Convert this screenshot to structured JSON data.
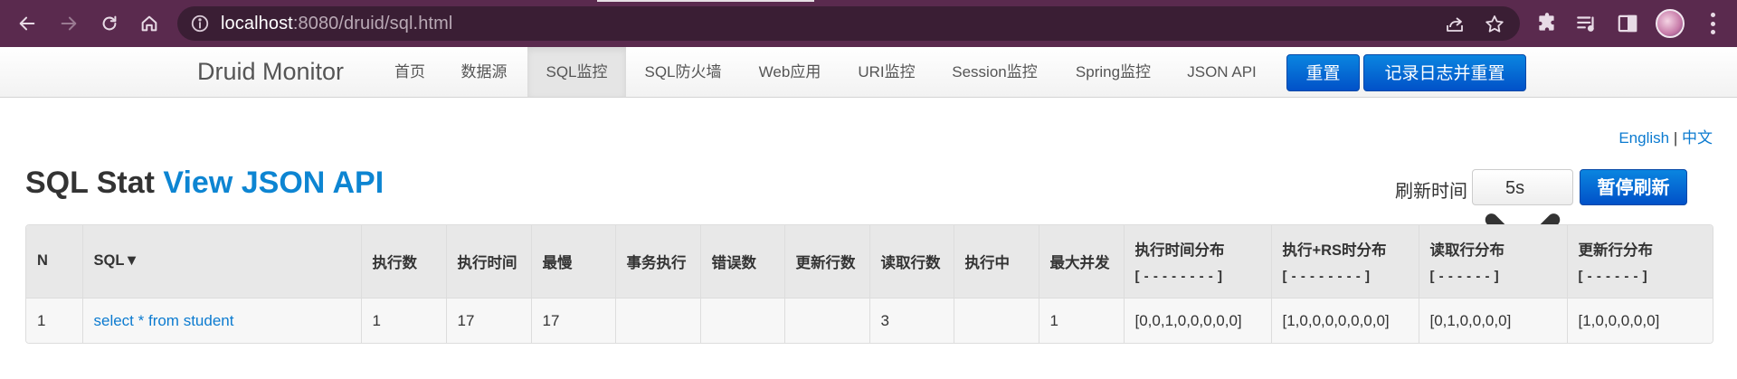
{
  "browser": {
    "url_host": "localhost",
    "url_rest": ":8080/druid/sql.html"
  },
  "navbar": {
    "brand": "Druid Monitor",
    "items": [
      {
        "label": "首页",
        "active": false
      },
      {
        "label": "数据源",
        "active": false
      },
      {
        "label": "SQL监控",
        "active": true
      },
      {
        "label": "SQL防火墙",
        "active": false
      },
      {
        "label": "Web应用",
        "active": false
      },
      {
        "label": "URI监控",
        "active": false
      },
      {
        "label": "Session监控",
        "active": false
      },
      {
        "label": "Spring监控",
        "active": false
      },
      {
        "label": "JSON API",
        "active": false
      }
    ],
    "reset_label": "重置",
    "log_reset_label": "记录日志并重置"
  },
  "lang": {
    "english": "English",
    "separator": "|",
    "chinese": "中文"
  },
  "heading": {
    "title": "SQL Stat",
    "api_link": "View JSON API"
  },
  "refresh": {
    "label": "刷新时间",
    "selected": "5s",
    "pause_label": "暂停刷新"
  },
  "table": {
    "columns": [
      {
        "label": "N",
        "sub": ""
      },
      {
        "label": "SQL▼",
        "sub": ""
      },
      {
        "label": "执行数",
        "sub": ""
      },
      {
        "label": "执行时间",
        "sub": ""
      },
      {
        "label": "最慢",
        "sub": ""
      },
      {
        "label": "事务执行",
        "sub": ""
      },
      {
        "label": "错误数",
        "sub": ""
      },
      {
        "label": "更新行数",
        "sub": ""
      },
      {
        "label": "读取行数",
        "sub": ""
      },
      {
        "label": "执行中",
        "sub": ""
      },
      {
        "label": "最大并发",
        "sub": ""
      },
      {
        "label": "执行时间分布",
        "sub": "[ - - - - - - - - ]"
      },
      {
        "label": "执行+RS时分布",
        "sub": "[ - - - - - - - - ]"
      },
      {
        "label": "读取行分布",
        "sub": "[ - - - - - - ]"
      },
      {
        "label": "更新行分布",
        "sub": "[ - - - - - - ]"
      }
    ],
    "rows": [
      [
        "1",
        "select * from student",
        "1",
        "17",
        "17",
        "",
        "",
        "",
        "3",
        "",
        "1",
        "[0,0,1,0,0,0,0,0]",
        "[1,0,0,0,0,0,0,0]",
        "[0,1,0,0,0,0]",
        "[1,0,0,0,0,0]"
      ]
    ]
  }
}
